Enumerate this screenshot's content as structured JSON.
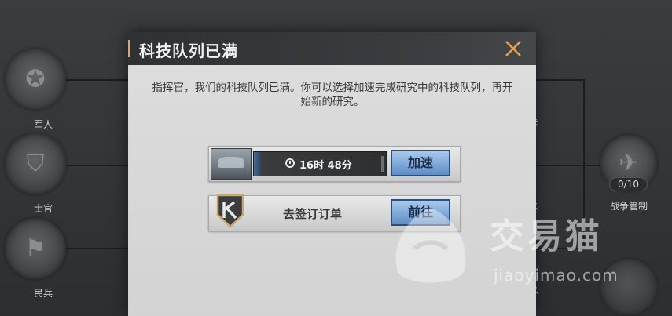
{
  "background_tree": {
    "nodes": [
      {
        "label": "军人",
        "icon": "soldier-icon"
      },
      {
        "label": "士官",
        "icon": "officer-icon"
      },
      {
        "label": "民兵",
        "icon": "militia-icon"
      }
    ],
    "right_labels": [
      "战术",
      "战术",
      "战术"
    ],
    "right_node": {
      "label": "战争管制",
      "counter": "0/10",
      "icon": "war-control-icon"
    }
  },
  "dialog": {
    "title": "科技队列已满",
    "message": "指挥官，我们的科技队列已满。你可以选择加速完成研究中的科技队列，再开始新的研究。",
    "close_icon": "close-icon",
    "accent_color": "#d9a860"
  },
  "options": [
    {
      "timer": "16时 48分",
      "button": "加速",
      "thumbnail": "research-thumbnail"
    },
    {
      "label": "去签订订单",
      "button": "前往",
      "badge": "k-emblem-icon"
    }
  ],
  "watermark": {
    "brand": "交易猫",
    "site": "jiaoyimao.com"
  }
}
